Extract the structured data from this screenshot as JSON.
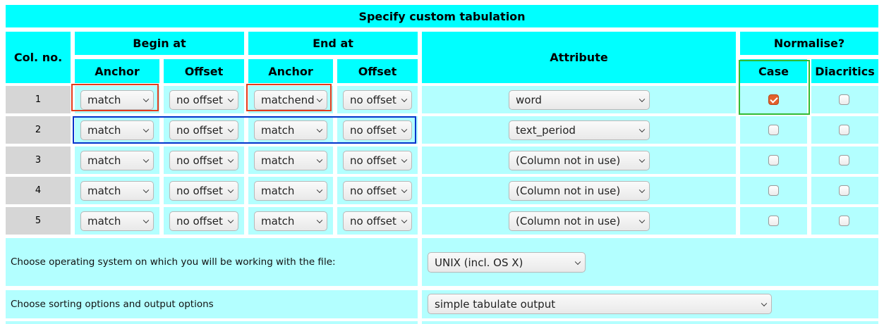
{
  "title": "Specify custom tabulation",
  "headers": {
    "col_no": "Col. no.",
    "begin_at": "Begin at",
    "end_at": "End at",
    "anchor": "Anchor",
    "offset": "Offset",
    "attribute": "Attribute",
    "normalise": "Normalise?",
    "case": "Case",
    "diacritics": "Diacritics"
  },
  "rows": [
    {
      "num": "1",
      "begin_anchor": "match",
      "begin_offset": "no offset",
      "end_anchor": "matchend",
      "end_offset": "no offset",
      "attribute": "word",
      "case": true,
      "diacritics": false
    },
    {
      "num": "2",
      "begin_anchor": "match",
      "begin_offset": "no offset",
      "end_anchor": "match",
      "end_offset": "no offset",
      "attribute": "text_period",
      "case": false,
      "diacritics": false
    },
    {
      "num": "3",
      "begin_anchor": "match",
      "begin_offset": "no offset",
      "end_anchor": "match",
      "end_offset": "no offset",
      "attribute": "(Column not in use)",
      "case": false,
      "diacritics": false
    },
    {
      "num": "4",
      "begin_anchor": "match",
      "begin_offset": "no offset",
      "end_anchor": "match",
      "end_offset": "no offset",
      "attribute": "(Column not in use)",
      "case": false,
      "diacritics": false
    },
    {
      "num": "5",
      "begin_anchor": "match",
      "begin_offset": "no offset",
      "end_anchor": "match",
      "end_offset": "no offset",
      "attribute": "(Column not in use)",
      "case": false,
      "diacritics": false
    }
  ],
  "os_option": {
    "label": "Choose operating system on which you will be working with the file:",
    "value": "UNIX (incl. OS X)"
  },
  "sort_option": {
    "label": "Choose sorting options and output options",
    "value": "simple tabulate output"
  },
  "colors": {
    "header_bg": "#00ffff",
    "row_bg": "#b3ffff",
    "number_bg": "#d6d6d6",
    "red_highlight": "#e53b1b",
    "blue_highlight": "#0033cc",
    "green_highlight": "#33bb33",
    "checkbox_checked": "#e2612c"
  }
}
